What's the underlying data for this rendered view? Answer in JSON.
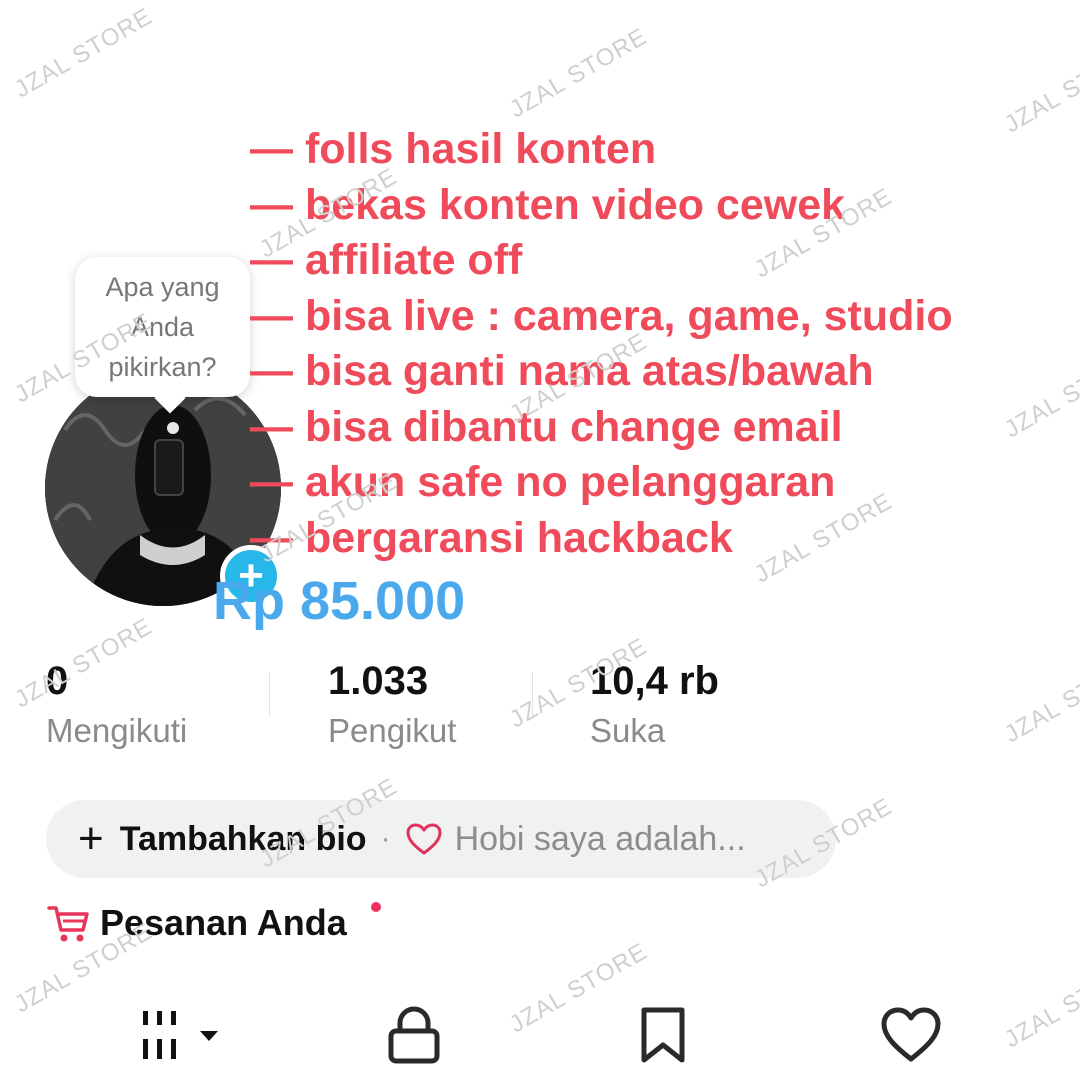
{
  "watermark": "JZAL STORE",
  "bubble": {
    "text": "Apa yang Anda pikirkan?"
  },
  "features": [
    "— folls hasil konten",
    "— bekas konten video cewek",
    "— affiliate off",
    "— bisa live : camera, game, studio",
    "— bisa ganti nama atas/bawah",
    "— bisa dibantu change email",
    "— akun safe no pelanggaran",
    "— bergaransi hackback"
  ],
  "price": "Rp 85.000",
  "avatar": {
    "plus_icon": "+"
  },
  "stats": {
    "following": {
      "value": "0",
      "label": "Mengikuti"
    },
    "followers": {
      "value": "1.033",
      "label": "Pengikut"
    },
    "likes": {
      "value": "10,4 rb",
      "label": "Suka"
    }
  },
  "bio": {
    "add_icon": "+",
    "add_label": "Tambahkan bio",
    "separator": "·",
    "hobby_placeholder": "Hobi saya adalah..."
  },
  "orders": {
    "label": "Pesanan Anda"
  },
  "tabs": [
    {
      "icon": "grid-icon",
      "name": "videos"
    },
    {
      "icon": "lock-icon",
      "name": "private"
    },
    {
      "icon": "bookmark-icon",
      "name": "saved"
    },
    {
      "icon": "heart-icon",
      "name": "liked"
    }
  ],
  "colors": {
    "feature_text": "#f04b5a",
    "price_text": "#4aa8ec",
    "accent_blue": "#27b7e8",
    "badge_red": "#f0315a"
  }
}
